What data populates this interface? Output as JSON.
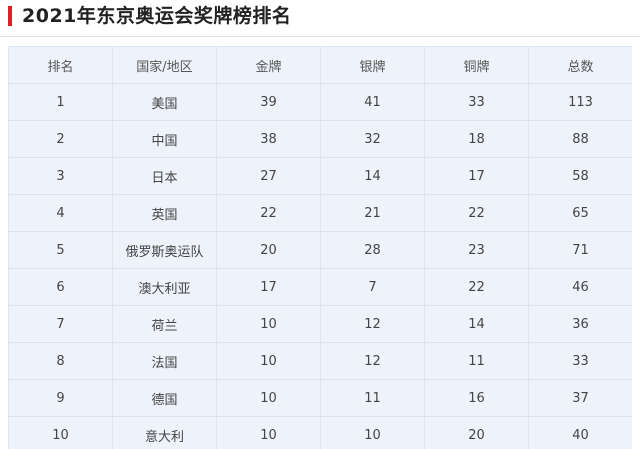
{
  "title": "2021年东京奥运会奖牌榜排名",
  "colors": {
    "accent_mark": "#e02020",
    "cell_background": "#eef3fb",
    "cell_border": "#dde3ec"
  },
  "table": {
    "headers": [
      "排名",
      "国家/地区",
      "金牌",
      "银牌",
      "铜牌",
      "总数"
    ],
    "rows": [
      [
        "1",
        "美国",
        "39",
        "41",
        "33",
        "113"
      ],
      [
        "2",
        "中国",
        "38",
        "32",
        "18",
        "88"
      ],
      [
        "3",
        "日本",
        "27",
        "14",
        "17",
        "58"
      ],
      [
        "4",
        "英国",
        "22",
        "21",
        "22",
        "65"
      ],
      [
        "5",
        "俄罗斯奥运队",
        "20",
        "28",
        "23",
        "71"
      ],
      [
        "6",
        "澳大利亚",
        "17",
        "7",
        "22",
        "46"
      ],
      [
        "7",
        "荷兰",
        "10",
        "12",
        "14",
        "36"
      ],
      [
        "8",
        "法国",
        "10",
        "12",
        "11",
        "33"
      ],
      [
        "9",
        "德国",
        "10",
        "11",
        "16",
        "37"
      ],
      [
        "10",
        "意大利",
        "10",
        "10",
        "20",
        "40"
      ]
    ]
  }
}
